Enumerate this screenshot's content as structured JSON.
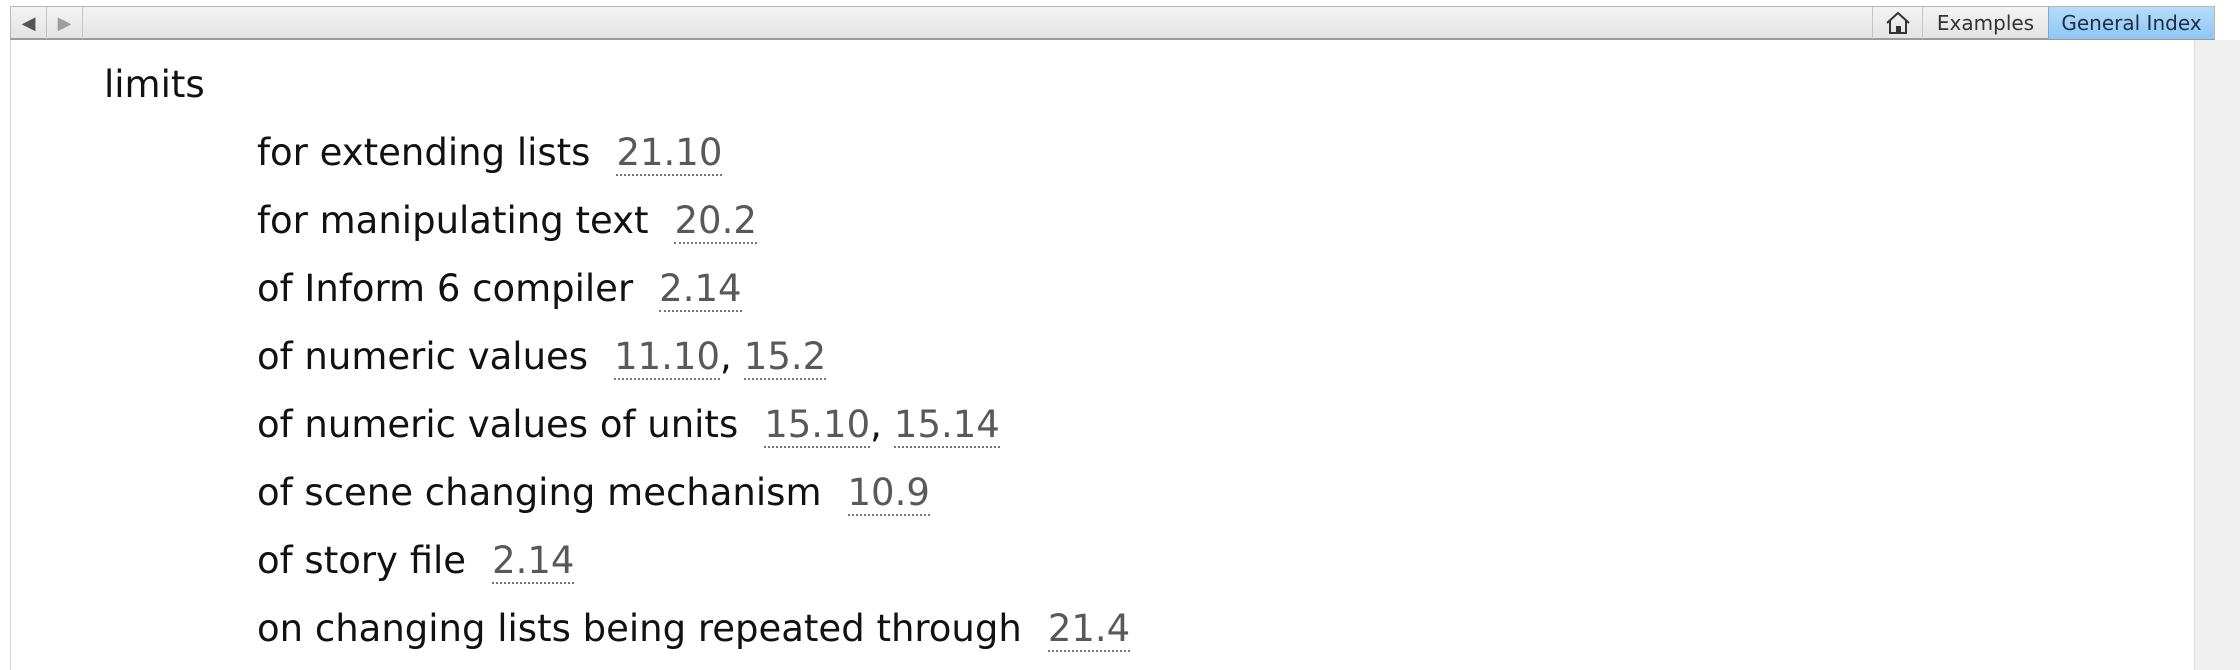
{
  "toolbar": {
    "back_icon": "back-arrow-icon",
    "forward_icon": "forward-arrow-icon",
    "home_icon": "home-icon",
    "examples_label": "Examples",
    "general_index_label": "General Index",
    "active_tab_color": "#9ccff8"
  },
  "index": {
    "heading": "limits",
    "entries": [
      {
        "label": "for extending lists",
        "refs": [
          "21.10"
        ]
      },
      {
        "label": "for manipulating text",
        "refs": [
          "20.2"
        ]
      },
      {
        "label": "of Inform 6 compiler",
        "refs": [
          "2.14"
        ]
      },
      {
        "label": "of numeric values",
        "refs": [
          "11.10",
          "15.2"
        ]
      },
      {
        "label": "of numeric values of units",
        "refs": [
          "15.10",
          "15.14"
        ]
      },
      {
        "label": "of scene changing mechanism",
        "refs": [
          "10.9"
        ]
      },
      {
        "label": "of story file",
        "refs": [
          "2.14"
        ]
      },
      {
        "label": "on changing lists being repeated through",
        "refs": [
          "21.4"
        ]
      }
    ]
  }
}
